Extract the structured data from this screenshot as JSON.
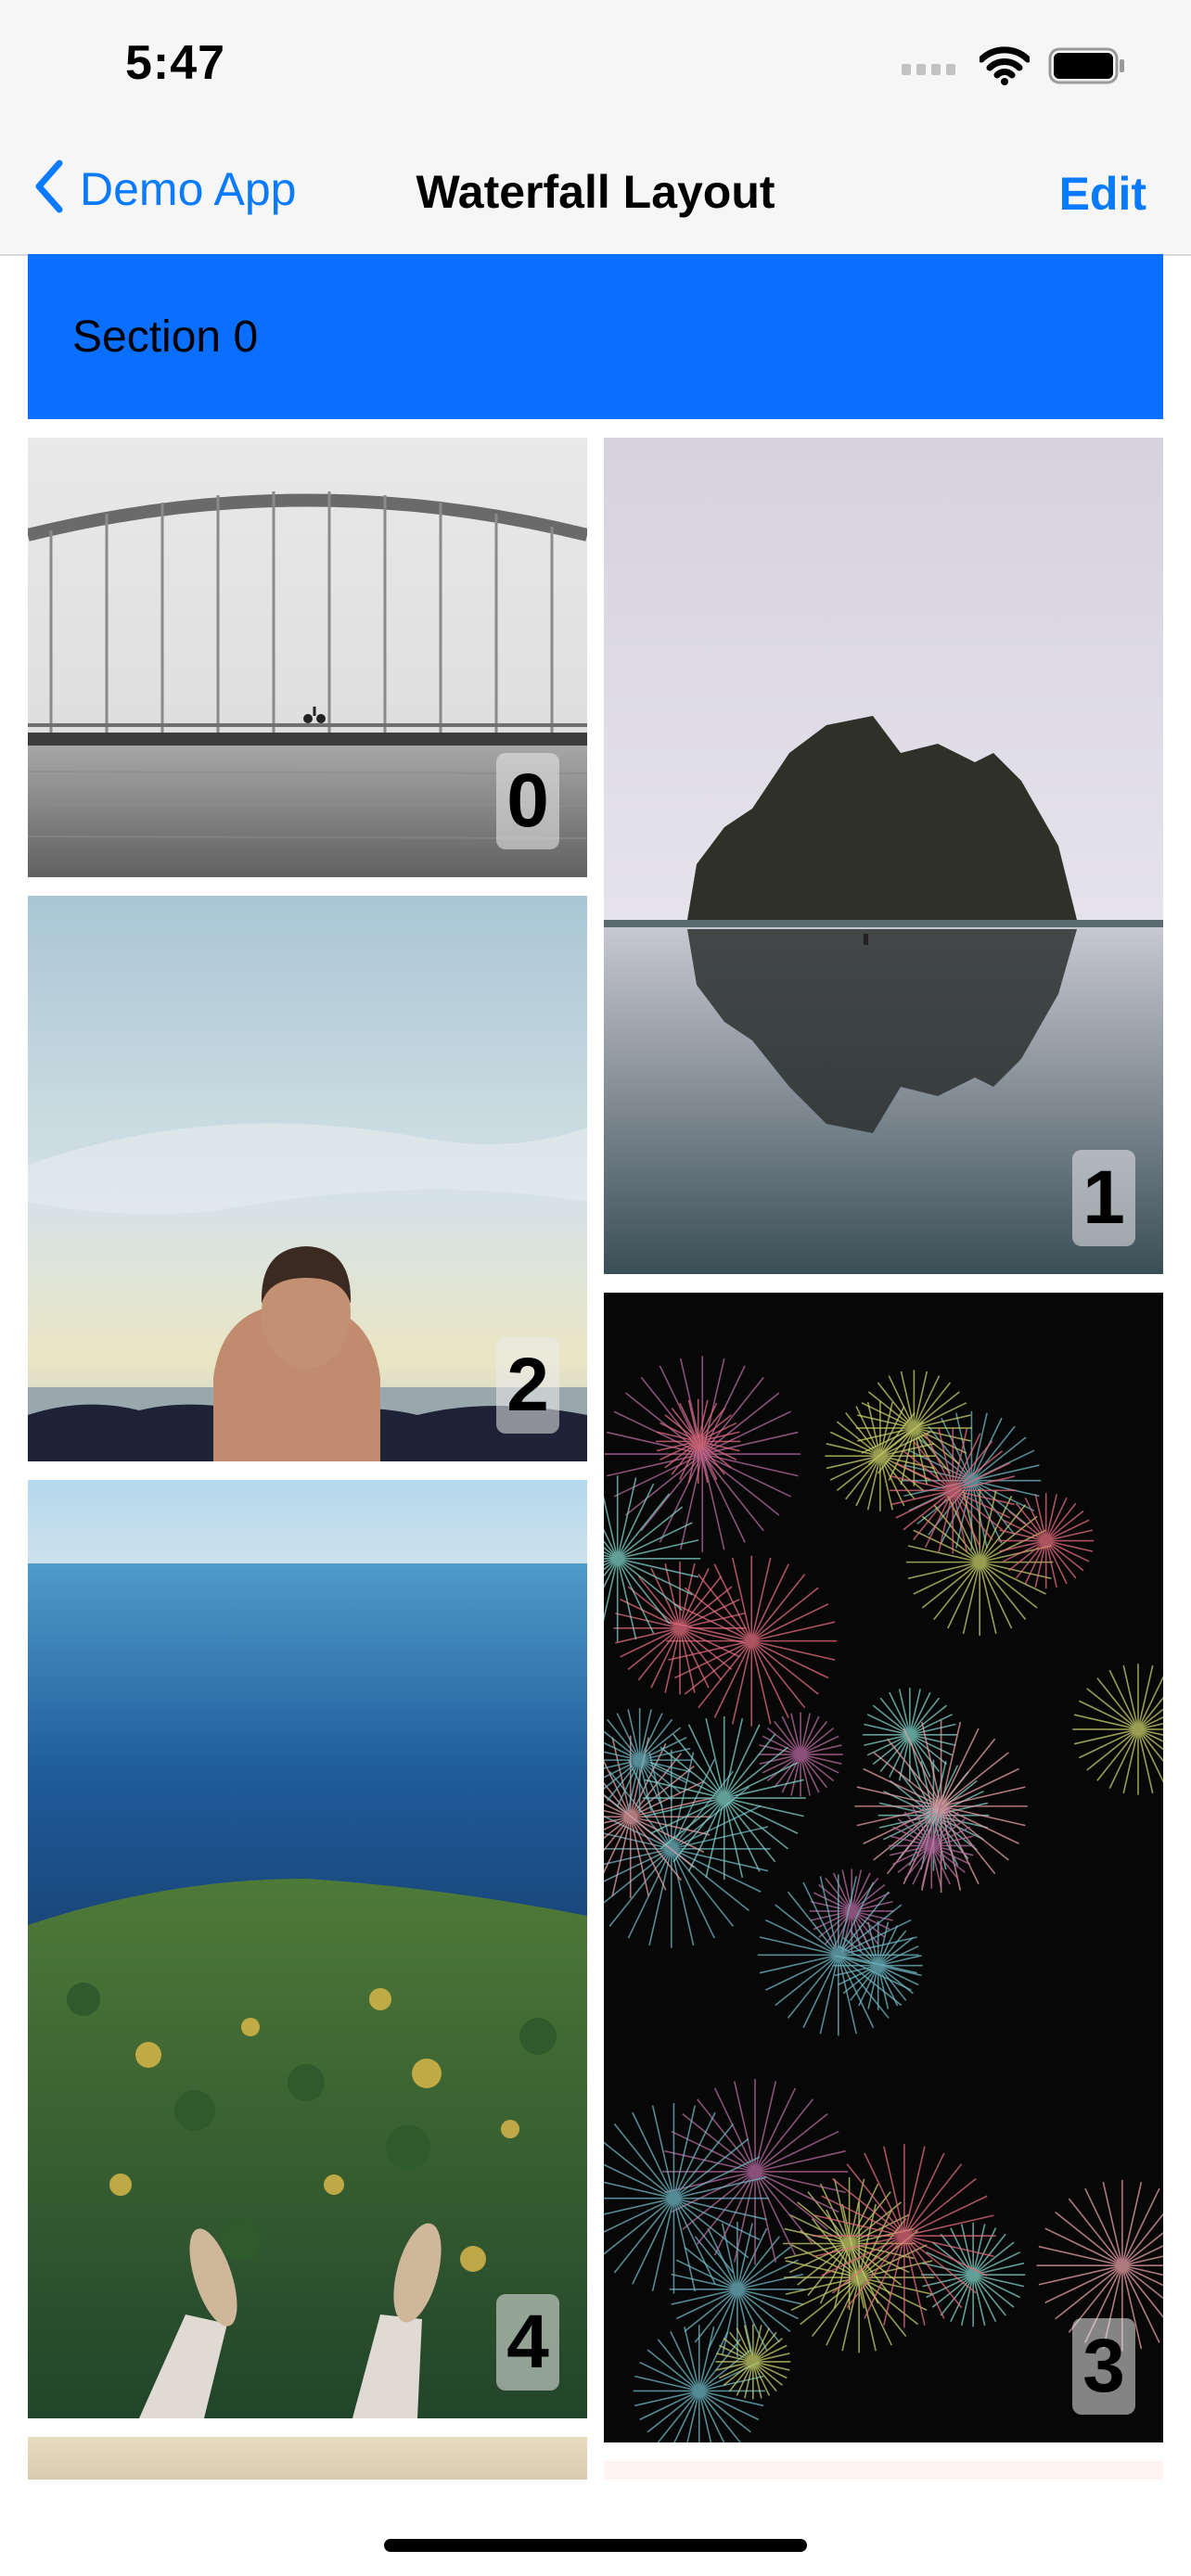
{
  "status_bar": {
    "time": "5:47"
  },
  "nav": {
    "back_label": "Demo App",
    "title": "Waterfall Layout",
    "edit_label": "Edit"
  },
  "section": {
    "title": "Section 0"
  },
  "items": [
    {
      "index": "0",
      "photo": "bridge-cyclist"
    },
    {
      "index": "1",
      "photo": "sea-rock-reflection"
    },
    {
      "index": "2",
      "photo": "man-facing-sea"
    },
    {
      "index": "3",
      "photo": "fireworks"
    },
    {
      "index": "4",
      "photo": "forest-cliff-feet"
    }
  ],
  "colors": {
    "accent": "#0a7aff",
    "section_header": "#0a6eff",
    "nav_background": "#f6f6f6"
  }
}
